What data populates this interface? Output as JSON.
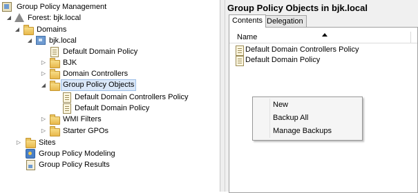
{
  "tree": {
    "items": [
      {
        "label": "Group Policy Management",
        "icon": "gpm-icon",
        "expander": "none"
      },
      {
        "label": "Forest: bjk.local",
        "icon": "forest-icon",
        "expander": "expanded"
      },
      {
        "label": "Domains",
        "icon": "folder-icon",
        "expander": "expanded"
      },
      {
        "label": "bjk.local",
        "icon": "domain-icon",
        "expander": "expanded"
      },
      {
        "label": "Default Domain Policy",
        "icon": "gpo-link-icon",
        "expander": "none"
      },
      {
        "label": "BJK",
        "icon": "ou-folder-icon",
        "expander": "collapsed"
      },
      {
        "label": "Domain Controllers",
        "icon": "ou-folder-icon",
        "expander": "collapsed"
      },
      {
        "label": "Group Policy Objects",
        "icon": "folder-icon",
        "expander": "expanded",
        "selected": true
      },
      {
        "label": "Default Domain Controllers Policy",
        "icon": "gpo-icon",
        "expander": "none"
      },
      {
        "label": "Default Domain Policy",
        "icon": "gpo-icon",
        "expander": "none"
      },
      {
        "label": "WMI Filters",
        "icon": "folder-icon",
        "expander": "collapsed"
      },
      {
        "label": "Starter GPOs",
        "icon": "folder-icon",
        "expander": "collapsed"
      },
      {
        "label": "Sites",
        "icon": "sites-icon",
        "expander": "collapsed"
      },
      {
        "label": "Group Policy Modeling",
        "icon": "modeling-icon",
        "expander": "none"
      },
      {
        "label": "Group Policy Results",
        "icon": "results-icon",
        "expander": "none"
      }
    ]
  },
  "details": {
    "title": "Group Policy Objects in bjk.local",
    "tabs": [
      "Contents",
      "Delegation"
    ],
    "active_tab": "Contents",
    "column_header": "Name",
    "rows": [
      "Default Domain Controllers Policy",
      "Default Domain Policy"
    ]
  },
  "context_menu": {
    "items": [
      "New",
      "Backup All",
      "Manage Backups"
    ]
  },
  "colors": {
    "selection": "#d9e7f8",
    "selection_border": "#9fc0e8",
    "pane_background": "#f0f0f0"
  }
}
